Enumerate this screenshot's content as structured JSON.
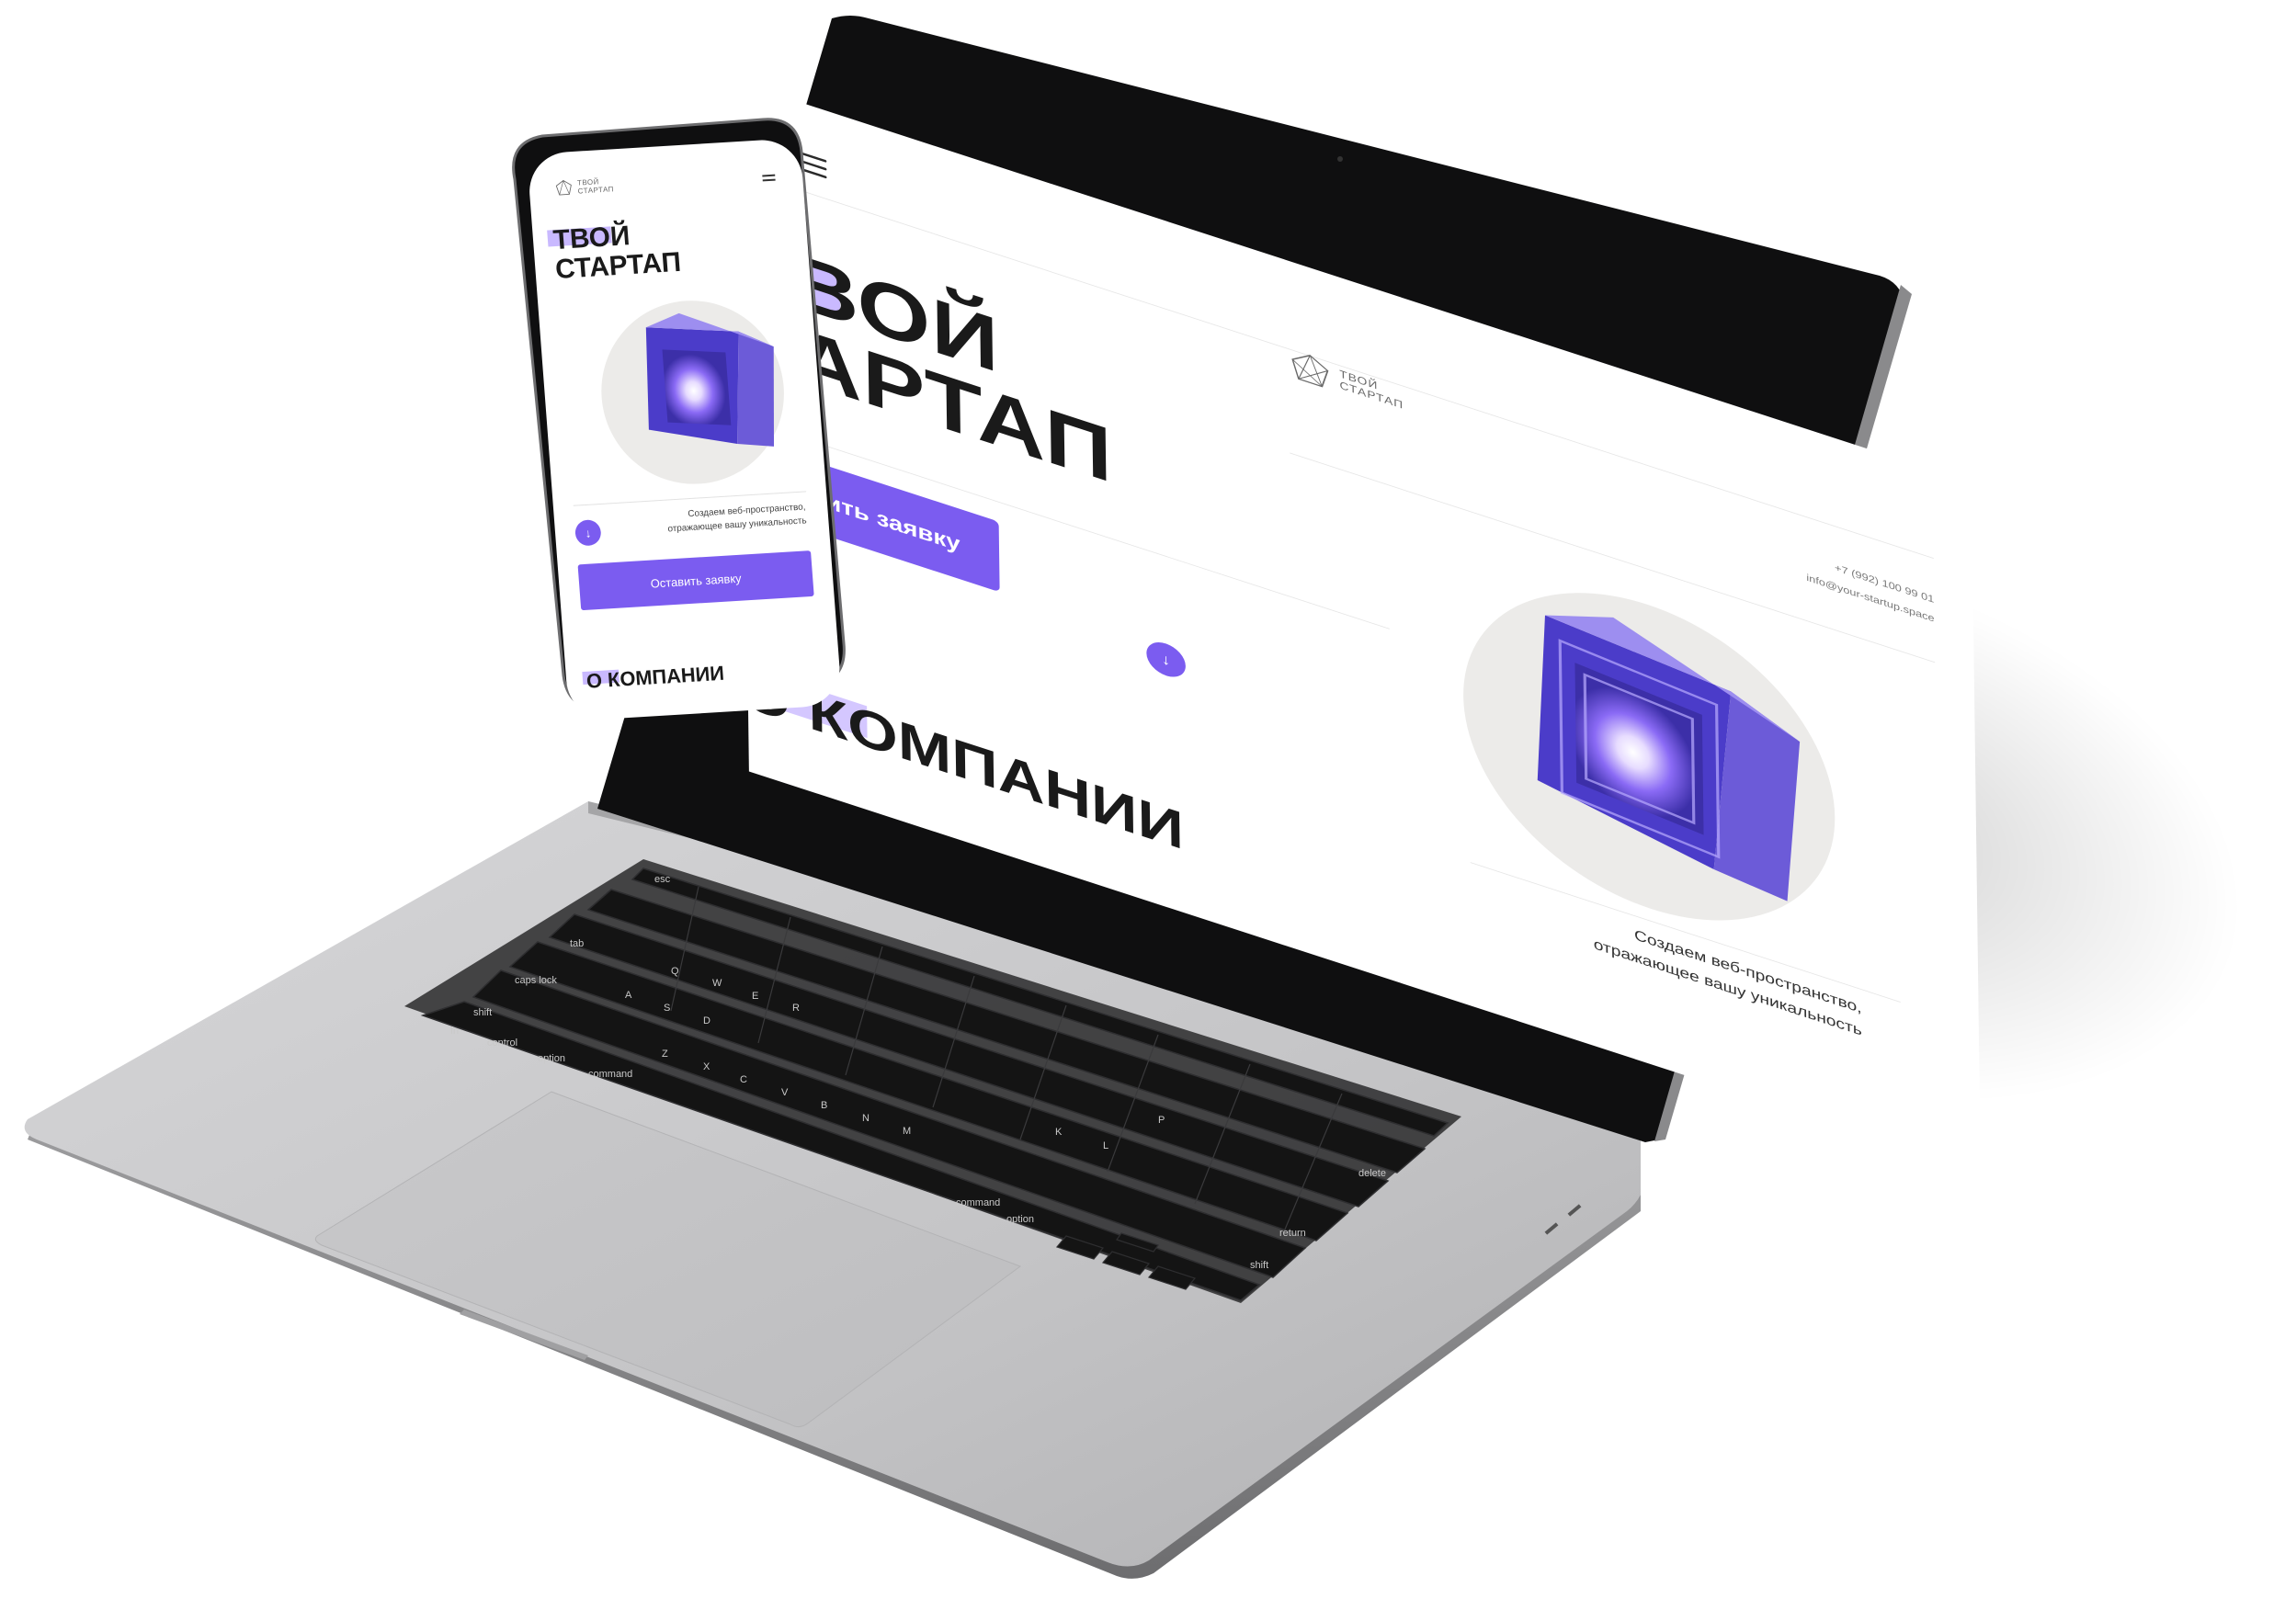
{
  "desktop": {
    "logo": {
      "line1": "ТВОЙ",
      "line2": "СТАРТАП"
    },
    "phone_number": "+7 (992) 100 99 01",
    "email": "info@your-startup.space",
    "hero_title_line1": "ТВОЙ",
    "hero_title_line2": "СТАРТАП",
    "cta_label": "Оставить заявку",
    "scroll_arrow": "↓",
    "tagline": "Создаем веб-пространство, отражающее вашу уникальность",
    "about_heading": "О КОМПАНИИ"
  },
  "mobile": {
    "logo": {
      "line1": "ТВОЙ",
      "line2": "СТАРТАП"
    },
    "hero_title_line1": "ТВОЙ",
    "hero_title_line2": "СТАРТАП",
    "tagline": "Создаем веб-пространство, отражающее вашу уникальность",
    "scroll_arrow": "↓",
    "cta_label": "Оставить заявку",
    "about_heading": "О КОМПАНИИ"
  },
  "keyboard": {
    "keys": [
      "esc",
      "tab",
      "caps lock",
      "shift",
      "fn",
      "control",
      "option",
      "command",
      "Q",
      "W",
      "E",
      "R",
      "A",
      "S",
      "D",
      "Z",
      "X",
      "C",
      "V",
      "B",
      "N",
      "M",
      "K",
      "L",
      "P",
      "delete",
      "return",
      "shift",
      "command",
      "option"
    ]
  },
  "theme": {
    "accent": "#7b5cf0",
    "highlight": "#c9b9ff",
    "text": "#1a1a1a",
    "circle": "#ecebe9",
    "aluminium": "#c8c8ca"
  }
}
